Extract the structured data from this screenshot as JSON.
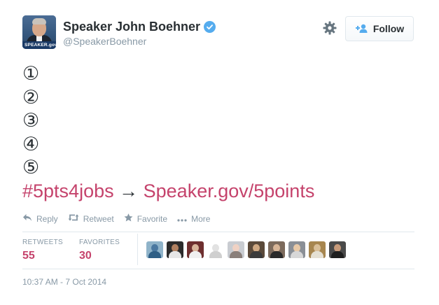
{
  "account": {
    "name": "Speaker John Boehner",
    "handle": "@SpeakerBoehner",
    "avatar_banner": "SPEAKER.gov",
    "follow_label": "Follow"
  },
  "tweet": {
    "numbers": [
      "①",
      "②",
      "③",
      "④",
      "⑤"
    ],
    "hashtag": "#5pts4jobs",
    "arrow": "→",
    "link": "Speaker.gov/5points"
  },
  "actions": {
    "reply": "Reply",
    "retweet": "Retweet",
    "favorite": "Favorite",
    "more": "More"
  },
  "stats": {
    "retweets_label": "RETWEETS",
    "retweets_count": "55",
    "favorites_label": "FAVORITES",
    "favorites_count": "30"
  },
  "timestamp": "10:37 AM - 7 Oct 2014",
  "colors": {
    "link": "#c5436c",
    "verified": "#55acee",
    "muted": "#8899a6",
    "text": "#292f33"
  }
}
